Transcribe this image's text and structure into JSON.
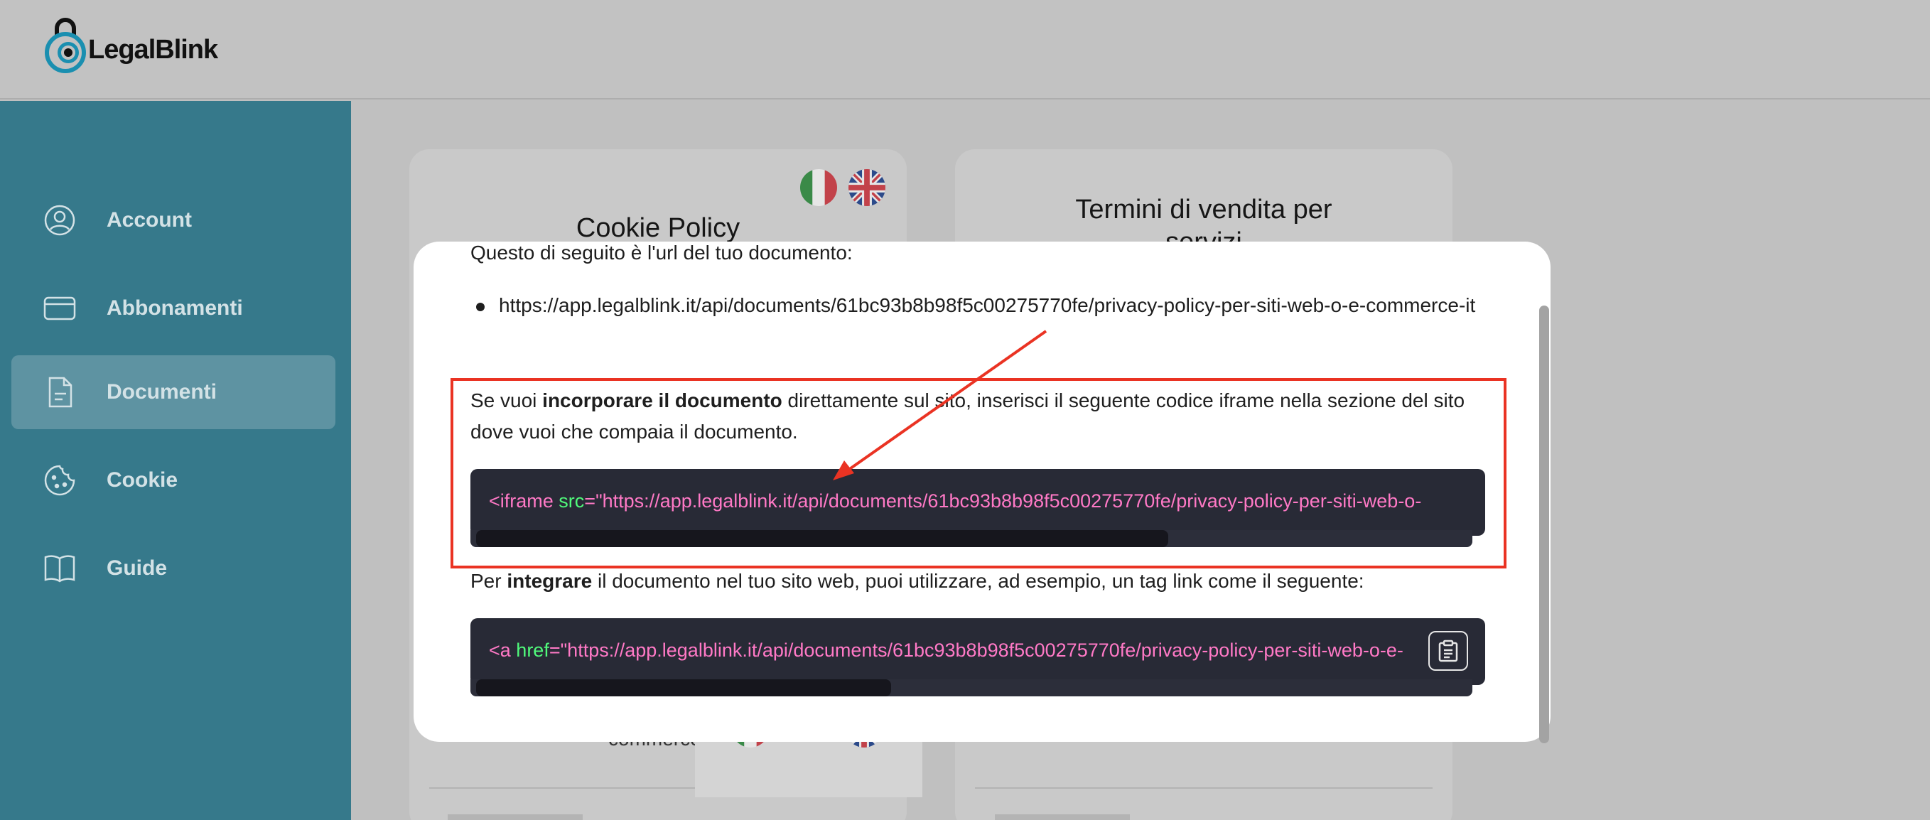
{
  "header": {
    "brand": "LegalBlink"
  },
  "sidebar": {
    "items": [
      {
        "label": "Account",
        "icon": "user-circle-icon"
      },
      {
        "label": "Abbonamenti",
        "icon": "credit-card-icon"
      },
      {
        "label": "Documenti",
        "icon": "document-icon",
        "active": true
      },
      {
        "label": "Cookie",
        "icon": "cookie-icon"
      },
      {
        "label": "Guide",
        "icon": "book-icon"
      }
    ]
  },
  "cards": {
    "cookie_title": "Cookie Policy",
    "terms_title_line1": "Termini di vendita per",
    "terms_title_line2": "servizi",
    "peek_text": "commerce"
  },
  "modal": {
    "intro": "Questo di seguito è l'url del tuo documento:",
    "url": "https://app.legalblink.it/api/documents/61bc93b8b98f5c00275770fe/privacy-policy-per-siti-web-o-e-commerce-it",
    "embed_pre": "Se vuoi ",
    "embed_bold": "incorporare il documento",
    "embed_post": " direttamente sul sito, inserisci il seguente codice iframe nella sezione del sito dove vuoi che compaia il documento.",
    "iframe_tag": "<iframe ",
    "iframe_attr": "src",
    "iframe_value": "=\"https://app.legalblink.it/api/documents/61bc93b8b98f5c00275770fe/privacy-policy-per-siti-web-o-",
    "integrate_pre": "Per ",
    "integrate_bold": "integrare",
    "integrate_post": " il documento nel tuo sito web, puoi utilizzare, ad esempio, un tag link come il seguente:",
    "link_tag": "<a ",
    "link_attr": "href",
    "link_value": "=\"https://app.legalblink.it/api/documents/61bc93b8b98f5c00275770fe/privacy-policy-per-siti-web-o-e-",
    "copy_icon": "clipboard-icon"
  },
  "colors": {
    "sidebar": "#36798b",
    "annotation": "#ea3323",
    "code_bg": "#282a36",
    "code_pink": "#ff79c6",
    "code_green": "#50fa7b"
  }
}
